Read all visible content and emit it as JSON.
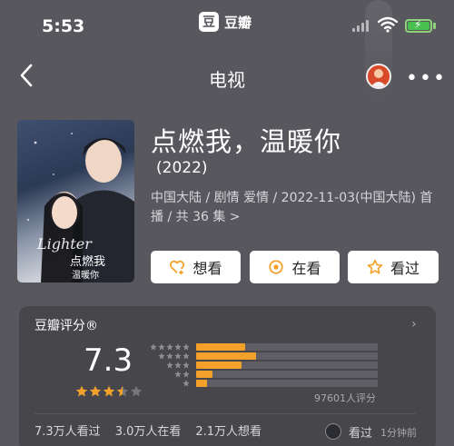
{
  "status_bar": {
    "time": "5:53",
    "app_logo_char": "豆",
    "app_name": "豆瓣"
  },
  "nav": {
    "title": "电视",
    "more": "•••"
  },
  "show": {
    "title": "点燃我，温暖你",
    "year": "(2022)",
    "meta": "中国大陆 / 剧情 爱情 / 2022-11-03(中国大陆) 首播 / 共 36 集 >",
    "poster_text": "点燃我，温暖你"
  },
  "actions": [
    {
      "label": "想看",
      "icon": "heart-plus-icon"
    },
    {
      "label": "在看",
      "icon": "target-icon"
    },
    {
      "label": "看过",
      "icon": "star-outline-icon"
    }
  ],
  "rating": {
    "label": "豆瓣评分®",
    "score": "7.3",
    "stars_filled": 3.5,
    "distribution": [
      {
        "stars": 5,
        "fraction": 0.27
      },
      {
        "stars": 4,
        "fraction": 0.33
      },
      {
        "stars": 3,
        "fraction": 0.25
      },
      {
        "stars": 2,
        "fraction": 0.09
      },
      {
        "stars": 1,
        "fraction": 0.06
      }
    ],
    "count": "97601人评分",
    "chevron": "›"
  },
  "stats": {
    "watched": "7.3万人看过",
    "watching": "3.0万人在看",
    "want": "2.1万人想看",
    "friend_label": "看过",
    "friend_time": "1分钟前"
  },
  "colors": {
    "background": "#58575d",
    "card": "#47464b",
    "accent": "#f4a12c",
    "battery": "#49c04f"
  }
}
